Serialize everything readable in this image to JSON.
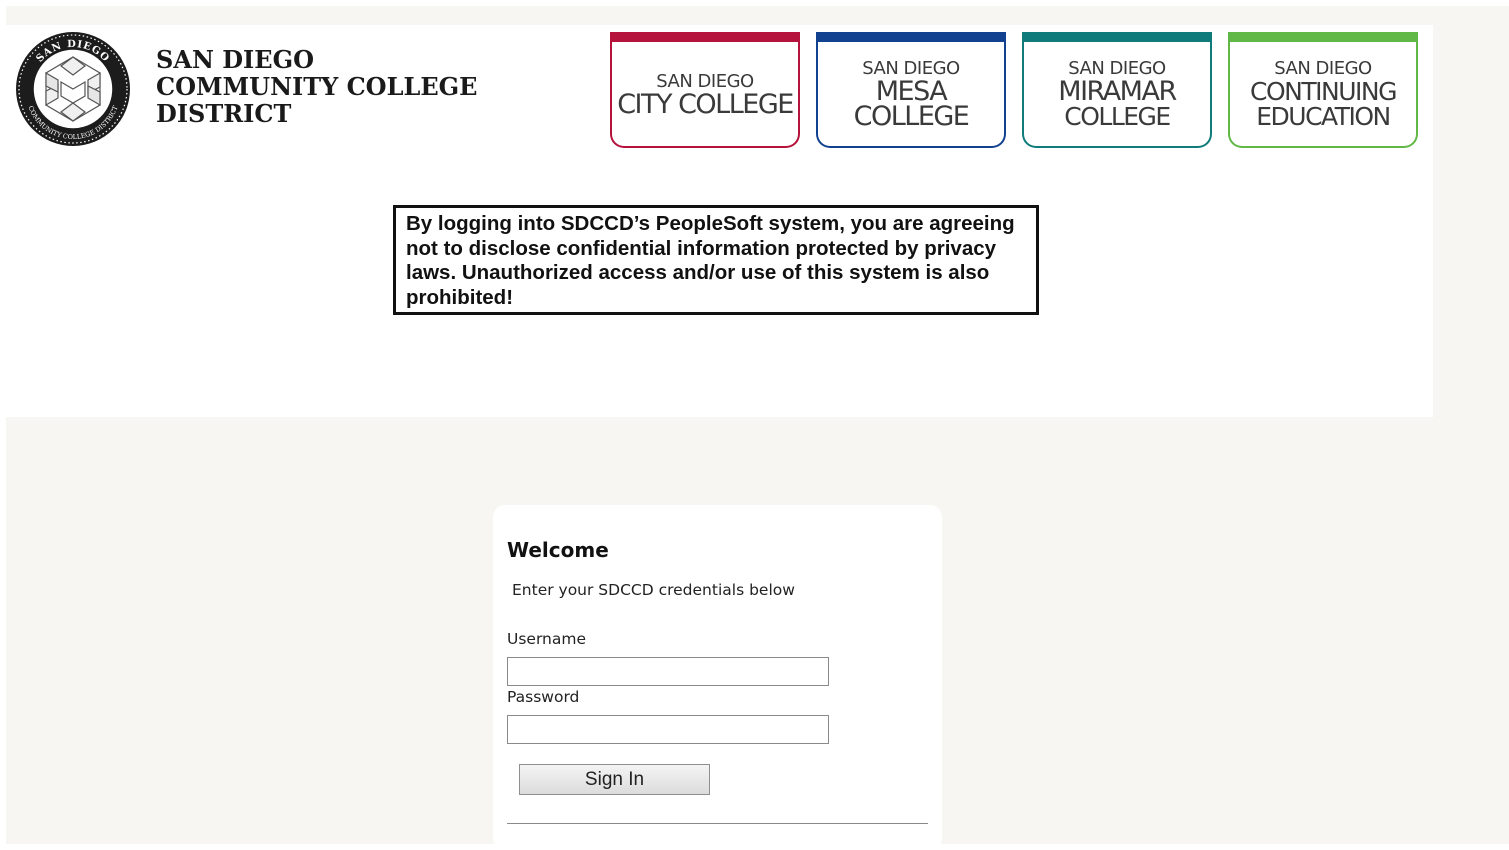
{
  "header": {
    "district_name_lines": [
      "SAN DIEGO",
      "COMMUNITY COLLEGE",
      "DISTRICT"
    ],
    "seal": {
      "top_text": "SAN DIEGO",
      "bottom_text": "COMMUNITY COLLEGE DISTRICT"
    },
    "colleges": [
      {
        "sub": "San Diego",
        "main": [
          "City College"
        ],
        "color": "#b5123c"
      },
      {
        "sub": "San Diego",
        "main": [
          "Mesa College"
        ],
        "color": "#12428f"
      },
      {
        "sub": "San Diego",
        "main": [
          "Miramar",
          "College"
        ],
        "color": "#107b7b"
      },
      {
        "sub": "San Diego",
        "main": [
          "Continuing",
          "Education"
        ],
        "color": "#62b846"
      }
    ]
  },
  "notice": {
    "text": "By logging into SDCCD’s PeopleSoft system, you are agreeing not to disclose confidential information protected by privacy laws.  Unauthorized access and/or use of this system is also prohibited!"
  },
  "login": {
    "title": "Welcome",
    "instructions": "Enter your SDCCD credentials below",
    "username_label": "Username",
    "username_value": "",
    "password_label": "Password",
    "password_value": "",
    "signin_label": "Sign In"
  }
}
